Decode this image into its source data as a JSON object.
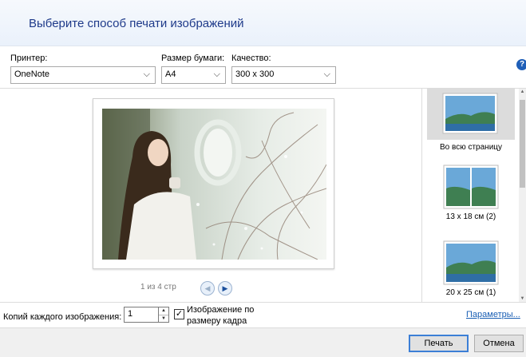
{
  "header": {
    "title": "Выберите способ печати изображений"
  },
  "options": {
    "printer": {
      "label": "Принтер:",
      "value": "OneNote"
    },
    "paper_size": {
      "label": "Размер бумаги:",
      "value": "A4"
    },
    "quality": {
      "label": "Качество:",
      "value": "300 x 300"
    }
  },
  "preview": {
    "pager_text": "1 из 4 стр",
    "prev_icon": "◀",
    "next_icon": "▶"
  },
  "layouts": [
    {
      "label": "Во всю страницу",
      "selected": true
    },
    {
      "label": "13 x 18 см (2)",
      "selected": false
    },
    {
      "label": "20 x 25 см (1)",
      "selected": false
    }
  ],
  "bottom": {
    "copies_label": "Копий каждого изображения:",
    "copies_value": "1",
    "fit_checked": "✓",
    "fit_label": "Изображение по размеру кадра",
    "params_link": "Параметры..."
  },
  "footer": {
    "print_label": "Печать",
    "cancel_label": "Отмена"
  },
  "help_icon": "?",
  "colors": {
    "accent": "#3c7fd6",
    "title": "#1e3a8a",
    "link": "#1a5fb4"
  }
}
